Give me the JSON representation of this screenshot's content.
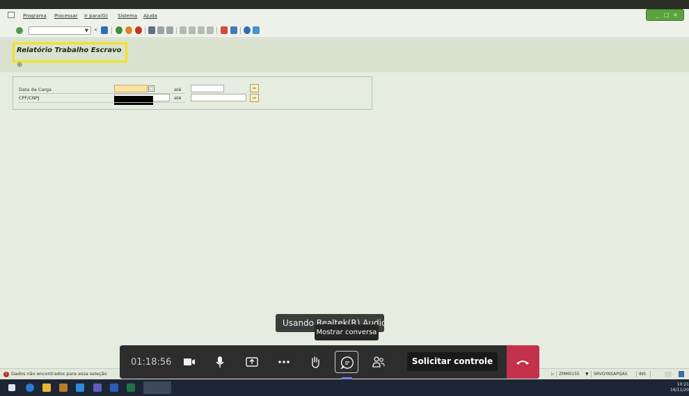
{
  "menu": {
    "items": [
      "Programa",
      "Processar",
      "Ir para(G)",
      "Sistema",
      "Ajuda"
    ]
  },
  "window_controls": [
    "_",
    "□",
    "×"
  ],
  "title": "Relatório Trabalho Escravo",
  "selection": {
    "rows": [
      {
        "label": "Data da Carga",
        "to_label": "até"
      },
      {
        "label": "CPF/CNPJ",
        "to_label": "até"
      }
    ]
  },
  "tooltips": {
    "audio": "Usando Realtek(R) Audio",
    "chat": "Mostrar conversa"
  },
  "call": {
    "timer": "01:18:56",
    "request_control": "Solicitar controle"
  },
  "status": {
    "message": "Dados não encontrados para essa seleção",
    "transaction": "ZMM0155",
    "server": "SRVGYNSAPQAS",
    "mode": "INS"
  },
  "clock": {
    "time": "10:21",
    "date": "16/11/20"
  },
  "colors": {
    "sap_background": "#e6ecdf",
    "highlight": "#f4e21c",
    "hangup": "#c4314b",
    "callbar": "#2d2d2d"
  }
}
